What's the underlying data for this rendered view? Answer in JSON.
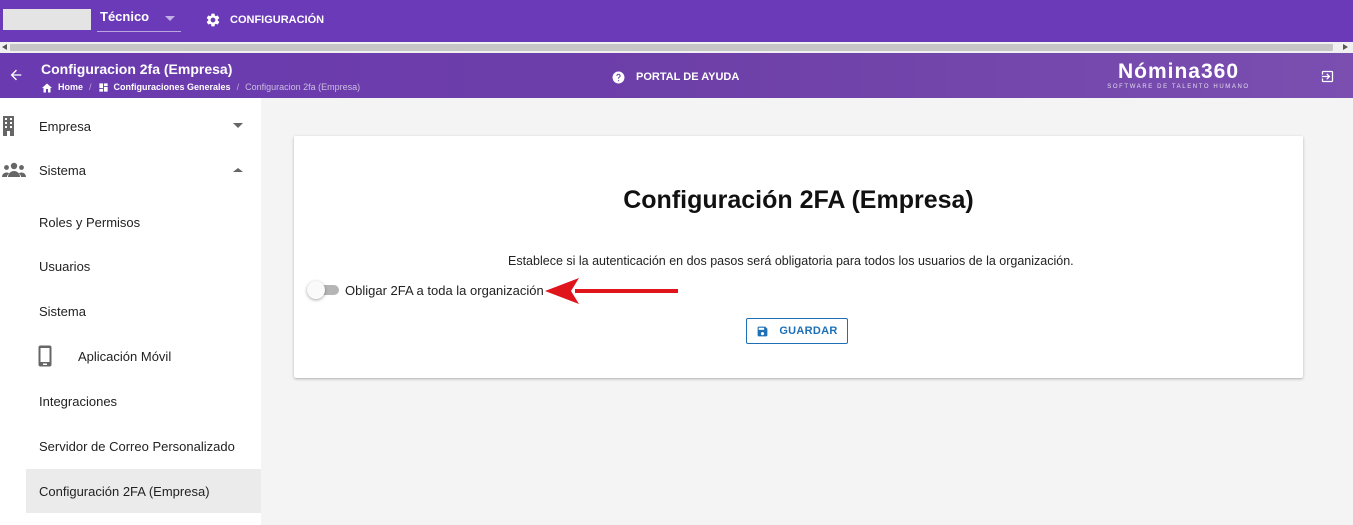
{
  "topbar": {
    "role_value": "Técnico",
    "config_label": "CONFIGURACIÓN"
  },
  "header": {
    "title": "Configuracion 2fa (Empresa)",
    "breadcrumb": {
      "home": "Home",
      "sep1": "/",
      "general": "Configuraciones Generales",
      "sep2": "/",
      "current": "Configuracion 2fa (Empresa)"
    },
    "help_label": "PORTAL DE AYUDA",
    "logo_name": "Nómina360",
    "logo_tagline": "SOFTWARE DE TALENTO HUMANO"
  },
  "sidebar": {
    "items": [
      {
        "label": "Empresa",
        "icon": "building-icon",
        "state": "collapsed"
      },
      {
        "label": "Sistema",
        "icon": "group-icon",
        "state": "expanded"
      },
      {
        "label": "Roles y Permisos"
      },
      {
        "label": "Usuarios"
      },
      {
        "label": "Sistema"
      },
      {
        "label": "Aplicación Móvil",
        "icon": "phone-icon"
      },
      {
        "label": "Integraciones"
      },
      {
        "label": "Servidor de Correo Personalizado"
      },
      {
        "label": "Configuración 2FA (Empresa)",
        "active": true
      }
    ]
  },
  "content": {
    "title": "Configuración 2FA (Empresa)",
    "description": "Establece si la autenticación en dos pasos será obligatoria para todos los usuarios de la organización.",
    "toggle_label": "Obligar 2FA a toda la organización",
    "toggle_on": false,
    "save_label": "GUARDAR"
  },
  "colors": {
    "topbar": "#6a3ab8",
    "accent_blue": "#1e6fb5",
    "annotation_red": "#e0141b"
  }
}
